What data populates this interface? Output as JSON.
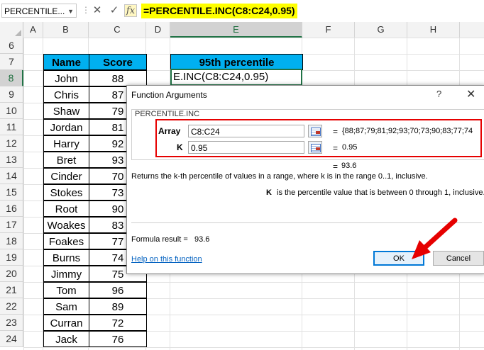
{
  "formula_bar": {
    "name_box": "PERCENTILE...",
    "cancel_symbol": "✕",
    "enter_symbol": "✓",
    "fx_symbol": "fx",
    "formula": "=PERCENTILE.INC(C8:C24,0.95)"
  },
  "grid": {
    "columns": [
      "A",
      "B",
      "C",
      "D",
      "E",
      "F",
      "G",
      "H"
    ],
    "selected_column": "E",
    "rows": [
      "6",
      "7",
      "8",
      "9",
      "10",
      "11",
      "12",
      "13",
      "14",
      "15",
      "16",
      "17",
      "18",
      "19",
      "20",
      "21",
      "22",
      "23",
      "24"
    ],
    "selected_row": "8"
  },
  "table": {
    "headers": {
      "name": "Name",
      "score": "Score"
    },
    "rows": [
      {
        "name": "John",
        "score": "88"
      },
      {
        "name": "Chris",
        "score": "87"
      },
      {
        "name": "Shaw",
        "score": "79"
      },
      {
        "name": "Jordan",
        "score": "81"
      },
      {
        "name": "Harry",
        "score": "92"
      },
      {
        "name": "Bret",
        "score": "93"
      },
      {
        "name": "Cinder",
        "score": "70"
      },
      {
        "name": "Stokes",
        "score": "73"
      },
      {
        "name": "Root",
        "score": "90"
      },
      {
        "name": "Woakes",
        "score": "83"
      },
      {
        "name": "Foakes",
        "score": "77"
      },
      {
        "name": "Burns",
        "score": "74"
      },
      {
        "name": "Jimmy",
        "score": "75"
      },
      {
        "name": "Tom",
        "score": "96"
      },
      {
        "name": "Sam",
        "score": "89"
      },
      {
        "name": "Curran",
        "score": "72"
      },
      {
        "name": "Jack",
        "score": "76"
      }
    ]
  },
  "percentile_header": "95th percentile",
  "active_cell_text": "E.INC(C8:C24,0.95)",
  "dialog": {
    "title": "Function Arguments",
    "help_symbol": "?",
    "close_symbol": "✕",
    "function_name": "PERCENTILE.INC",
    "args": [
      {
        "label": "Array",
        "value": "C8:C24",
        "result": "{88;87;79;81;92;93;70;73;90;83;77;74"
      },
      {
        "label": "K",
        "value": "0.95",
        "result": "0.95"
      }
    ],
    "equals": "=",
    "result_top": "93.6",
    "description": "Returns the k-th percentile of values in a range, where k is in the range 0..1, inclusive.",
    "arg_desc_name": "K",
    "arg_desc": "is the percentile value that is between 0 through 1, inclusive.",
    "formula_result_label": "Formula result =",
    "formula_result_value": "93.6",
    "help_link": "Help on this function",
    "ok_label": "OK",
    "cancel_label": "Cancel"
  },
  "colors": {
    "header_fill": "#00b0f0",
    "formula_highlight": "#ffff00",
    "annotation_red": "#e60000",
    "excel_green": "#217346"
  }
}
